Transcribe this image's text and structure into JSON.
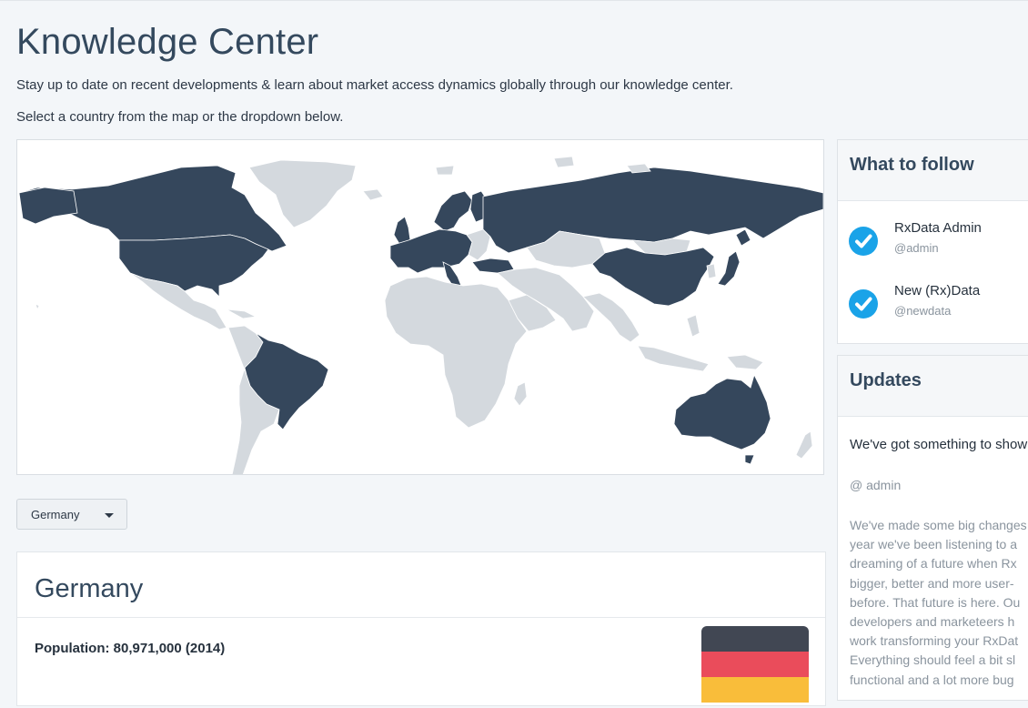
{
  "page": {
    "title": "Knowledge Center",
    "subtitle": "Stay up to date on recent developments & learn about market access dynamics globally through our knowledge center.",
    "instruction": "Select a country from the map or the dropdown below."
  },
  "map": {
    "highlight_color": "#35475c",
    "base_color": "#d4d9de",
    "highlighted_regions": [
      "Canada",
      "United States",
      "Brazil",
      "Australia",
      "Russia",
      "China",
      "Japan",
      "Turkey",
      "Western Europe",
      "Scandinavia"
    ]
  },
  "country_select": {
    "selected": "Germany"
  },
  "country_panel": {
    "name": "Germany",
    "population": "Population: 80,971,000 (2014)",
    "flag_colors": [
      "#414753",
      "#ea4c5b",
      "#f9bd3a"
    ]
  },
  "follow": {
    "title": "What to follow",
    "accounts": [
      {
        "name": "RxData Admin",
        "handle": "@admin"
      },
      {
        "name": "New (Rx)Data",
        "handle": "@newdata"
      }
    ]
  },
  "updates": {
    "title": "Updates",
    "headline": "We've got something to show",
    "author": "@ admin",
    "body_lines": [
      "We've made some big changes",
      "year we've been listening to a",
      "dreaming of a future when Rx",
      "bigger, better and more user-",
      "before. That future is here. Ou",
      "developers and marketeers h",
      "work transforming your RxDat",
      "Everything should feel a bit sl",
      "functional and a lot more bug"
    ]
  },
  "colors": {
    "accent": "#1aa3e8",
    "heading": "#34495e",
    "background": "#f3f6f9"
  }
}
